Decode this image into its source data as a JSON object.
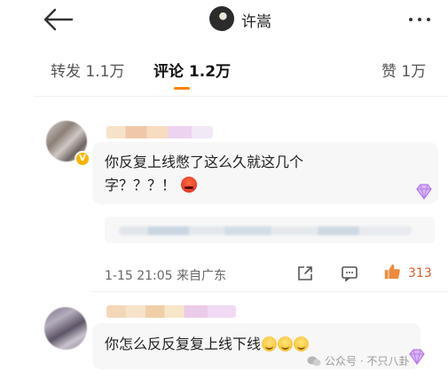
{
  "header": {
    "title": "许嵩"
  },
  "tabs": [
    {
      "label": "转发 1.1万"
    },
    {
      "label": "评论 1.2万"
    },
    {
      "label": "赞 1万"
    }
  ],
  "active_tab": "评论 1.2万",
  "colors": {
    "accent": "#ff8200",
    "like": "#e05a2b",
    "bubble": "#f7f7f7",
    "vip_badge": "#f7b500"
  },
  "comments": [
    {
      "text": "你反复上线憋了这么久就这几个字？？？！",
      "emoji": "angry-face",
      "timestamp": "1-15 21:05",
      "location": "来自广东",
      "like_count": "313"
    },
    {
      "text": "你怎么反反复复上线下线",
      "emoji": "grinning-face"
    }
  ],
  "watermark": {
    "label": "公众号 · 不只八卦"
  }
}
